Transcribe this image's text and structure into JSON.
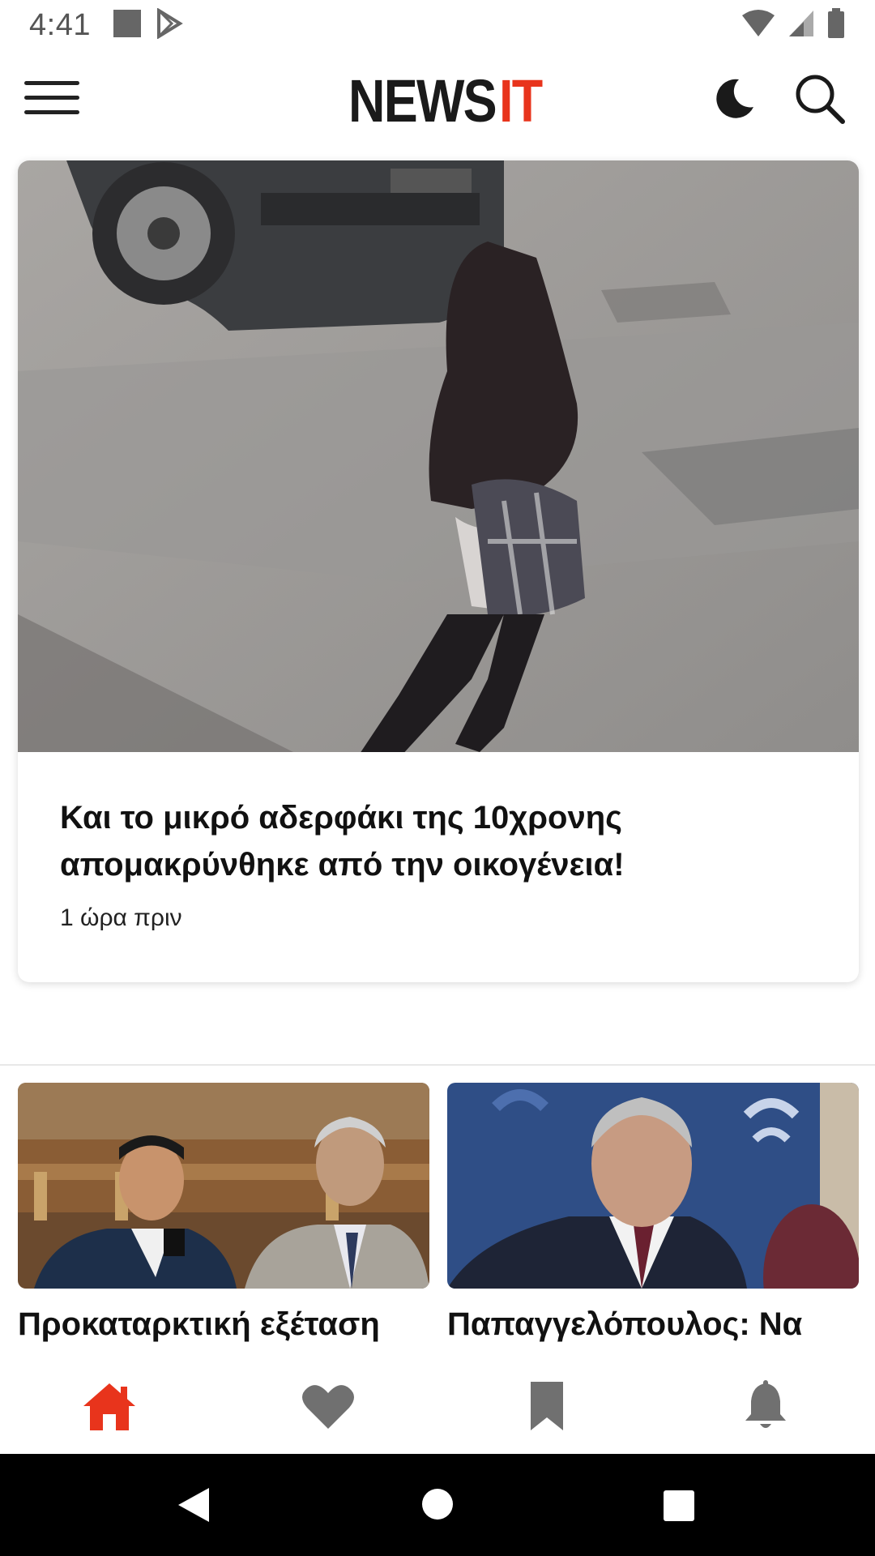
{
  "status_bar": {
    "time": "4:41",
    "icons": [
      "square-notification-icon",
      "play-store-icon",
      "wifi-icon",
      "signal-icon",
      "battery-icon"
    ]
  },
  "app_bar": {
    "logo_left": "NEWS",
    "logo_right": "IT",
    "menu_icon": "hamburger-menu-icon",
    "dark_mode_icon": "moon-icon",
    "search_icon": "search-icon"
  },
  "hero_article": {
    "title": "Και το μικρό αδερφάκι της 10χρονης απομακρύνθηκε από την οικογένεια!",
    "time": "1 ώρα πριν"
  },
  "articles": [
    {
      "title": "Προκαταρκτική εξέταση"
    },
    {
      "title": "Παπαγγελόπουλος: Να"
    }
  ],
  "bottom_nav": {
    "items": [
      "home-icon",
      "heart-icon",
      "bookmark-icon",
      "bell-icon"
    ],
    "active": "home-icon",
    "active_color": "#e8341c",
    "inactive_color": "#707070"
  },
  "colors": {
    "brand_red": "#e8341c",
    "logo_dark": "#1a1a1a"
  }
}
